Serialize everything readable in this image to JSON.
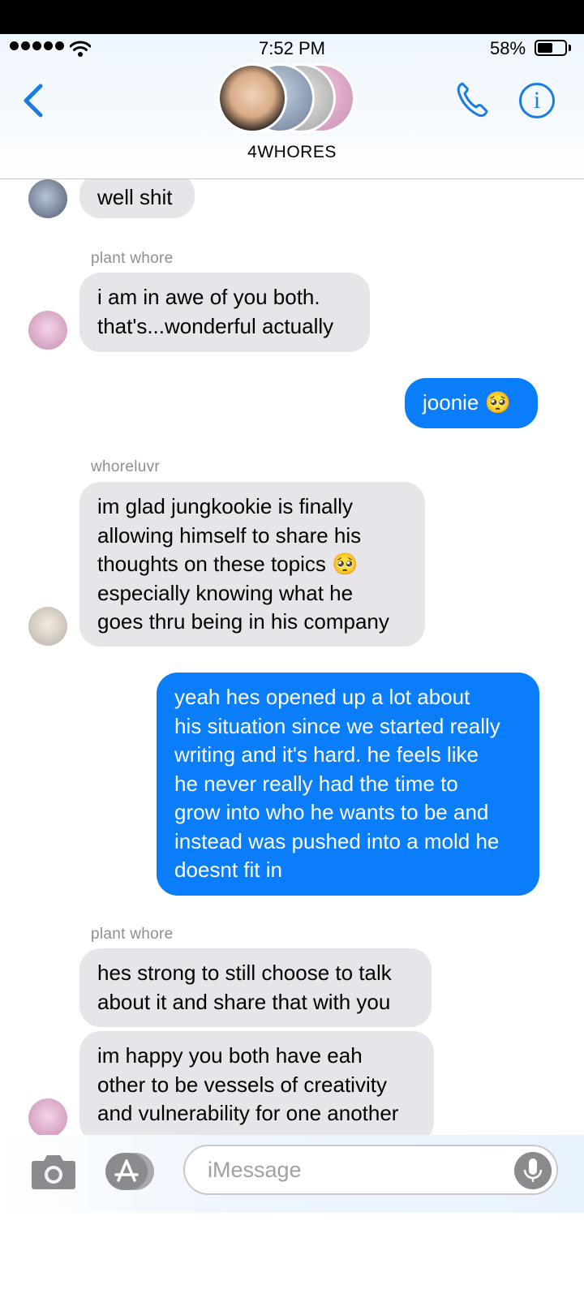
{
  "status_bar": {
    "time": "7:52 PM",
    "battery": "58%"
  },
  "header": {
    "group_name": "4WHORES"
  },
  "messages": [
    {
      "id": "m1",
      "text": "well shit"
    },
    {
      "id": "m2",
      "sender": "plant whore",
      "text": "i am in awe of you both.\nthat's...wonderful actually"
    },
    {
      "id": "m3",
      "text": "joonie 🥺"
    },
    {
      "id": "m4",
      "sender": "whoreluvr",
      "text": "im glad jungkookie is finally\nallowing himself to share his\nthoughts on these topics 🥺\nespecially knowing what he\ngoes thru being in his company"
    },
    {
      "id": "m5",
      "text": "yeah hes opened up a lot about\nhis situation since we started really\nwriting and it's hard. he feels like\nhe never really had the time to\ngrow into who he wants to be and\ninstead was pushed into a mold he\ndoesnt fit in"
    },
    {
      "id": "m6",
      "sender": "plant whore",
      "text": "hes strong to still choose to talk\nabout it and share that with you"
    },
    {
      "id": "m7",
      "text": "im happy you both have eah\nother to be vessels of creativity\nand vulnerability for one another"
    }
  ],
  "composer": {
    "placeholder": "iMessage"
  },
  "colors": {
    "accent": "#1a7ce3",
    "outgoing_bubble": "#0a7dfb",
    "incoming_bubble": "#e5e5ea"
  }
}
